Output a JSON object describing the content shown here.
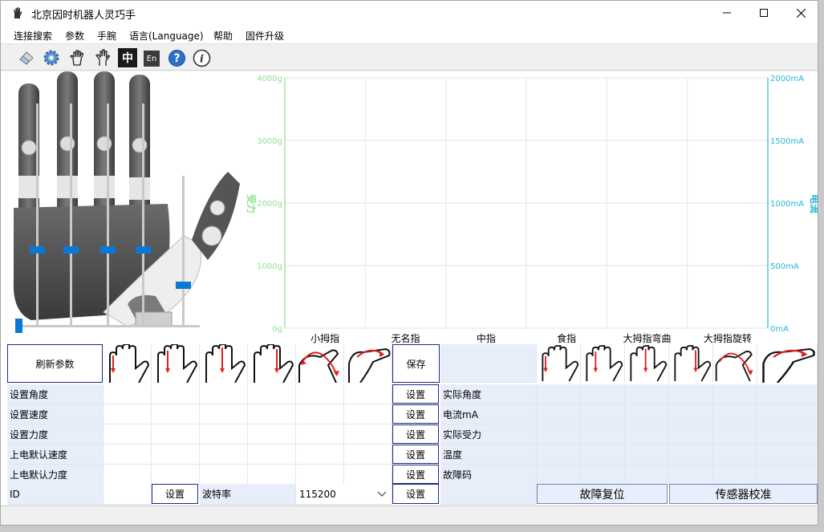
{
  "window": {
    "title": "北京因时机器人灵巧手"
  },
  "menu": [
    "连接搜索",
    "参数",
    "手腕",
    "语言(Language)",
    "帮助",
    "固件升级"
  ],
  "toolbar": {
    "icons": [
      "eraser-icon",
      "gear-icon",
      "open-hand-icon",
      "hand-outline-icon",
      "chinese-icon",
      "english-icon",
      "help-icon",
      "info-icon"
    ],
    "chinese_label": "中",
    "english_label": "En"
  },
  "sliders": {
    "fingers": [
      0.2,
      0.2,
      0.2,
      0.2
    ],
    "thumb_bend": 0.15,
    "thumb_rotate": 0.0
  },
  "chart_data": {
    "type": "bar",
    "categories": [
      "小拇指",
      "无名指",
      "中指",
      "食指",
      "大拇指弯曲",
      "大拇指旋转"
    ],
    "series": [
      {
        "name": "受力",
        "values": [
          0,
          0,
          0,
          0,
          0,
          0
        ],
        "color": "#90e090"
      },
      {
        "name": "电流",
        "values": [
          0,
          0,
          0,
          0,
          0,
          0
        ],
        "color": "#29b6d6"
      }
    ],
    "y_left": {
      "label": "受力",
      "ticks": [
        "0g",
        "1000g",
        "2000g",
        "3000g",
        "4000g"
      ],
      "range": [
        0,
        4000
      ],
      "color": "#90e090"
    },
    "y_right": {
      "label": "电流",
      "ticks": [
        "0mA",
        "500mA",
        "1000mA",
        "1500mA",
        "2000mA"
      ],
      "range": [
        0,
        2000
      ],
      "color": "#29b6d6"
    },
    "grid": true
  },
  "controls": {
    "refresh": "刷新参数",
    "save": "保存",
    "set": "设置",
    "left_rows": [
      "设置角度",
      "设置速度",
      "设置力度",
      "上电默认速度",
      "上电默认力度"
    ],
    "right_rows": [
      "实际角度",
      "电流mA",
      "实际受力",
      "温度",
      "故障码"
    ],
    "id_label": "ID",
    "baud_label": "波特率",
    "baud_value": "115200",
    "fault_reset": "故障复位",
    "sensor_calib": "传感器校准"
  }
}
